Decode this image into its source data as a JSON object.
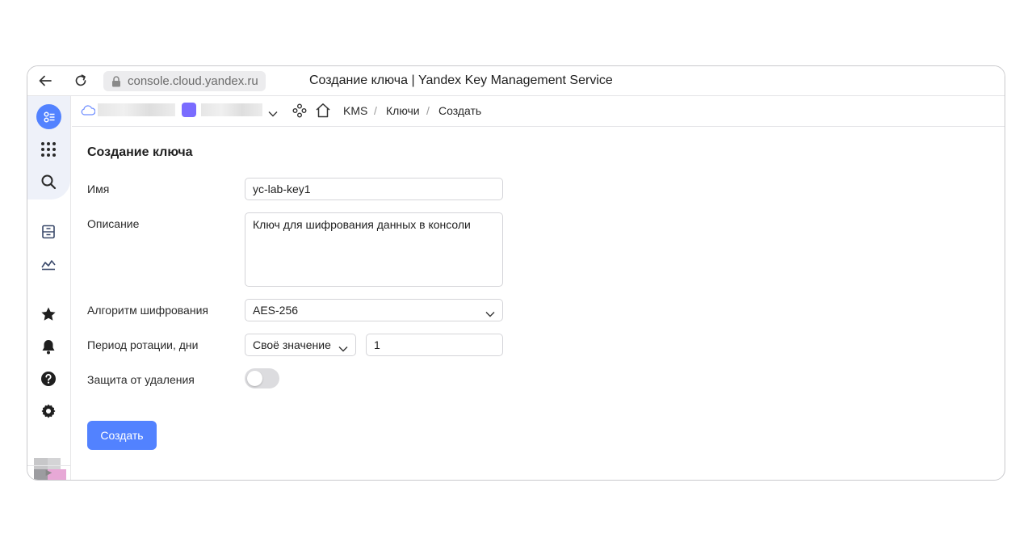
{
  "browser": {
    "url": "console.cloud.yandex.ru",
    "tab_title": "Создание ключа | Yandex Key Management Service"
  },
  "breadcrumbs": [
    {
      "label": "KMS"
    },
    {
      "label": "Ключи"
    },
    {
      "label": "Создать"
    }
  ],
  "breadcrumb_separator": "/",
  "form": {
    "title": "Создание ключа",
    "name_label": "Имя",
    "name_value": "yc-lab-key1",
    "description_label": "Описание",
    "description_value": "Ключ для шифрования данных в консоли",
    "algorithm_label": "Алгоритм шифрования",
    "algorithm_value": "AES-256",
    "rotation_label": "Период ротации, дни",
    "rotation_mode": "Своё значение",
    "rotation_value": "1",
    "deletion_protection_label": "Защита от удаления",
    "deletion_protection_on": false,
    "submit_label": "Создать"
  },
  "rail_icons": [
    "services-icon",
    "apps-grid-icon",
    "search-icon",
    "archive-icon",
    "dashboard-chart-icon",
    "star-icon",
    "bell-icon",
    "help-icon",
    "gear-icon"
  ],
  "colors": {
    "accent": "#5282ff",
    "folder_badge": "#7a6cff"
  }
}
